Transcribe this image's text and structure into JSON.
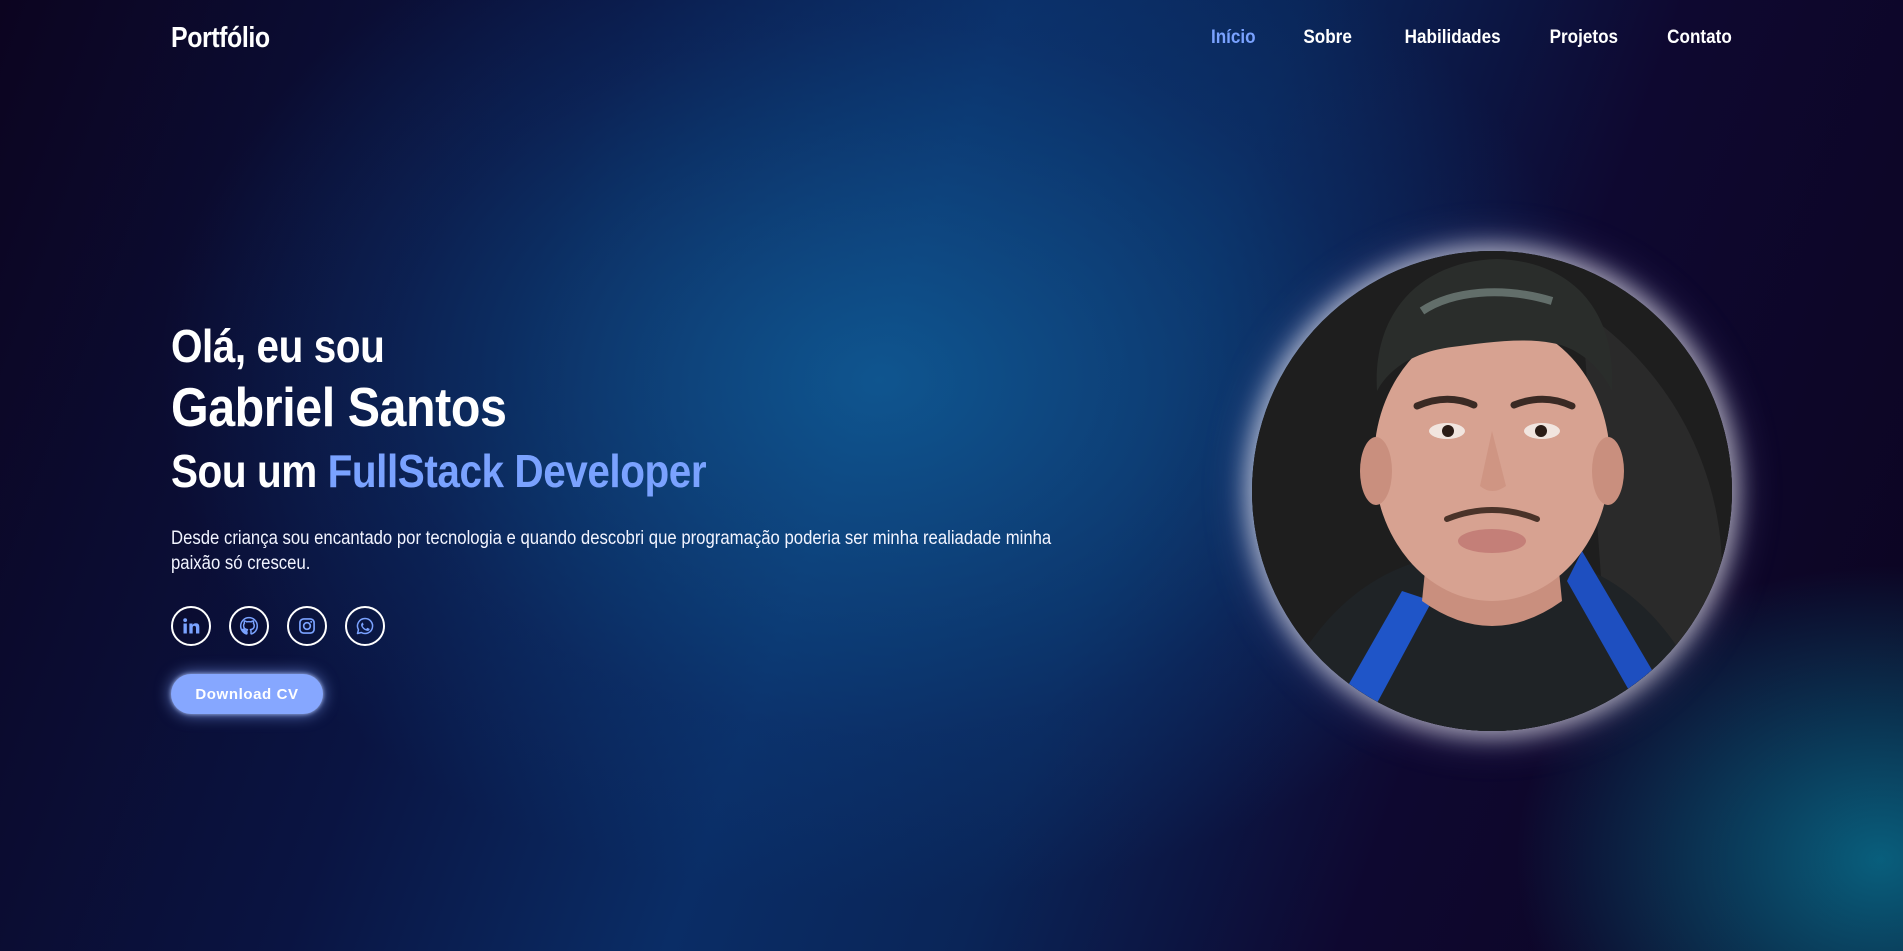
{
  "header": {
    "brand": "Portfólio",
    "nav": [
      {
        "label": "Início",
        "active": true
      },
      {
        "label": "Sobre",
        "active": false
      },
      {
        "label": "Habilidades",
        "active": false
      },
      {
        "label": "Projetos",
        "active": false
      },
      {
        "label": "Contato",
        "active": false
      }
    ]
  },
  "hero": {
    "greeting": "Olá, eu sou",
    "name": "Gabriel Santos",
    "role_prefix": "Sou um ",
    "role_highlight": "FullStack Developer",
    "description": "Desde criança sou encantado por tecnologia e quando descobri que programação poderia ser minha realiadade minha paixão só cresceu.",
    "socials": [
      {
        "icon": "linkedin-icon"
      },
      {
        "icon": "github-icon"
      },
      {
        "icon": "instagram-icon"
      },
      {
        "icon": "whatsapp-icon"
      }
    ],
    "cta_label": "Download CV"
  },
  "colors": {
    "accent": "#7aa2ff",
    "button": "#86a7ff",
    "background_dark": "#0c0420",
    "background_blue": "#0a2d66"
  }
}
